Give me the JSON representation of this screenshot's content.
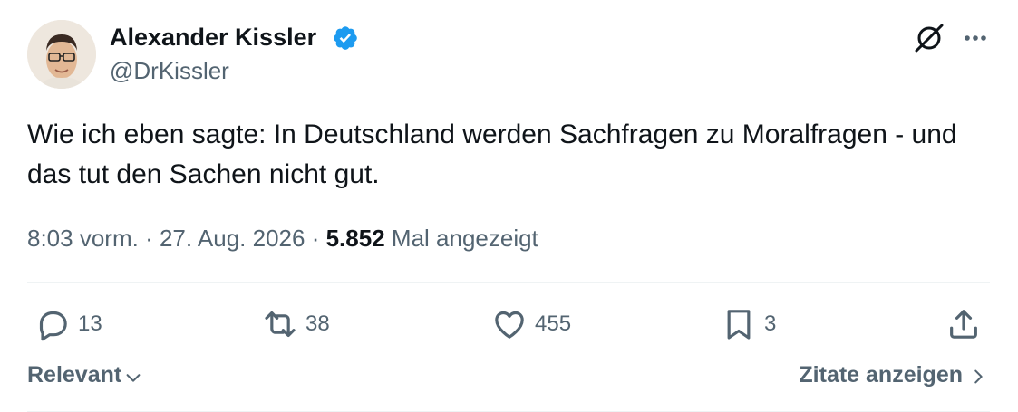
{
  "tweet": {
    "author_name": "Alexander Kissler",
    "handle": "@DrKissler",
    "text": "Wie ich eben sagte: In Deutschland werden Sachfragen zu Moralfragen - und das tut den Sachen nicht gut.",
    "time": "8:03 vorm.",
    "date": "27. Aug. 2026",
    "views": "5.852",
    "views_label": "Mal angezeigt",
    "separator": "·"
  },
  "actions": {
    "replies": "13",
    "reposts": "38",
    "likes": "455",
    "bookmarks": "3"
  },
  "footer": {
    "sort_label": "Relevant",
    "quotes_label": "Zitate anzeigen"
  },
  "colors": {
    "text": "#0f1419",
    "secondary": "#536471",
    "verified": "#1d9bf0",
    "divider": "#eff3f4"
  },
  "icons": [
    "verified-badge-icon",
    "grok-icon",
    "more-icon",
    "reply-icon",
    "repost-icon",
    "like-icon",
    "bookmark-icon",
    "share-icon",
    "chevron-down-icon",
    "chevron-right-icon"
  ]
}
